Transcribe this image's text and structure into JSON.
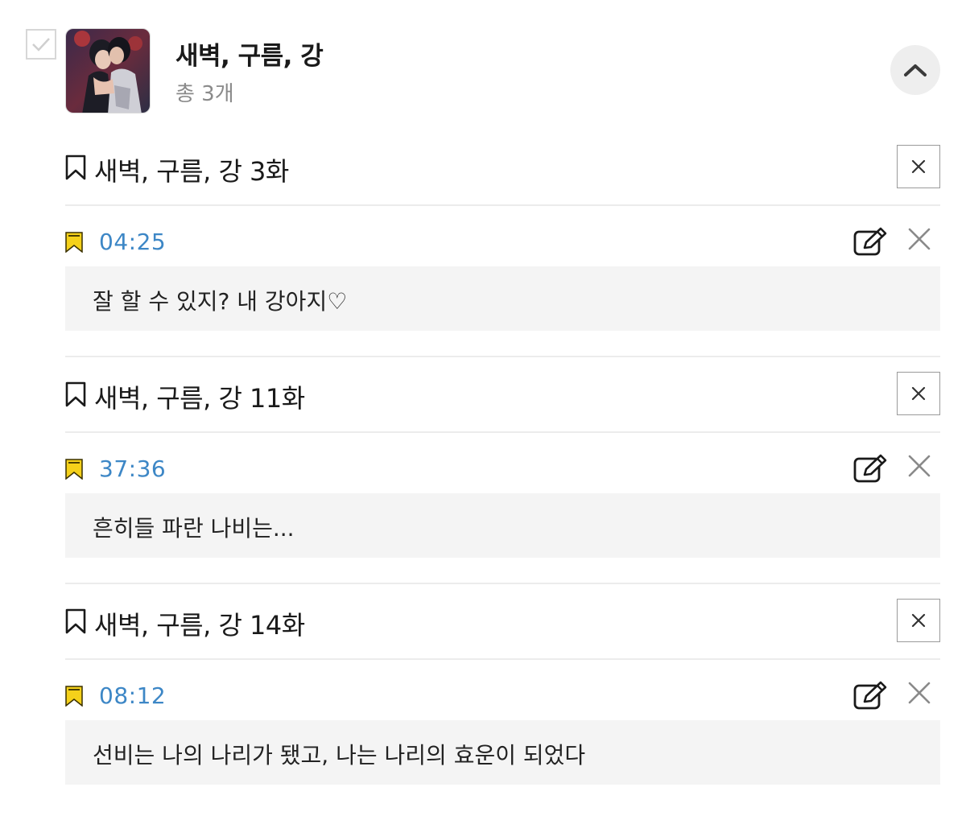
{
  "series": {
    "title": "새벽, 구름, 강",
    "count": "총 3개",
    "icons": {
      "checkbox": "check-icon",
      "collapse": "chevron-up-icon"
    }
  },
  "colors": {
    "accent_time": "#3d87c6",
    "flag_yellow": "#f5d11a",
    "note_background": "#f4f4f4"
  },
  "episodes": [
    {
      "title": "새벽, 구름, 강 3화",
      "note": {
        "time": "04:25",
        "text": "잘 할 수 있지? 내 강아지♡"
      }
    },
    {
      "title": "새벽, 구름, 강 11화",
      "note": {
        "time": "37:36",
        "text": "흔히들 파란 나비는..."
      }
    },
    {
      "title": "새벽, 구름, 강 14화",
      "note": {
        "time": "08:12",
        "text": "선비는 나의 나리가 됐고, 나는 나리의 효운이 되었다"
      }
    }
  ]
}
